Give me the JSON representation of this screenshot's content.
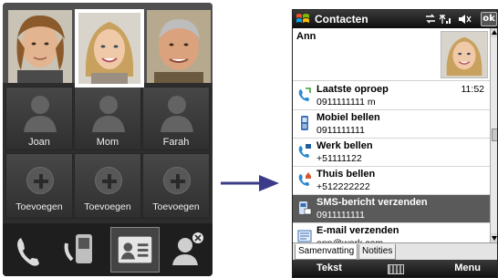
{
  "left_panel": {
    "contacts": [
      {
        "label": "Joan"
      },
      {
        "label": "Mom"
      },
      {
        "label": "Farah"
      }
    ],
    "add_label": "Toevoegen",
    "bottom_icons": [
      "phone-icon",
      "handset-sms-icon",
      "contact-card-icon",
      "remove-contact-icon"
    ]
  },
  "phone": {
    "title": "Contacten",
    "ok_label": "ok",
    "contact_name": "Ann",
    "rows": [
      {
        "label": "Laatste oproep",
        "value": "0911111111 m",
        "time": "11:52",
        "icon": "call-log-icon"
      },
      {
        "label": "Mobiel bellen",
        "value": "0911111111",
        "icon": "mobile-phone-icon"
      },
      {
        "label": "Werk bellen",
        "value": "+51111122",
        "icon": "work-call-icon"
      },
      {
        "label": "Thuis bellen",
        "value": "+512222222",
        "icon": "home-call-icon"
      },
      {
        "label": "SMS-bericht verzenden",
        "value": "0911111111",
        "icon": "sms-icon",
        "selected": true
      },
      {
        "label": "E-mail verzenden",
        "value": "ann@work.com",
        "icon": "email-icon"
      }
    ],
    "tabs": [
      "Samenvatting",
      "Notities"
    ],
    "softkeys": {
      "left": "Tekst",
      "right": "Menu"
    }
  },
  "colors": {
    "panel_bg": "#2d2d2d",
    "selection": "#5a5a5a",
    "arrow": "#3b3b8a"
  }
}
